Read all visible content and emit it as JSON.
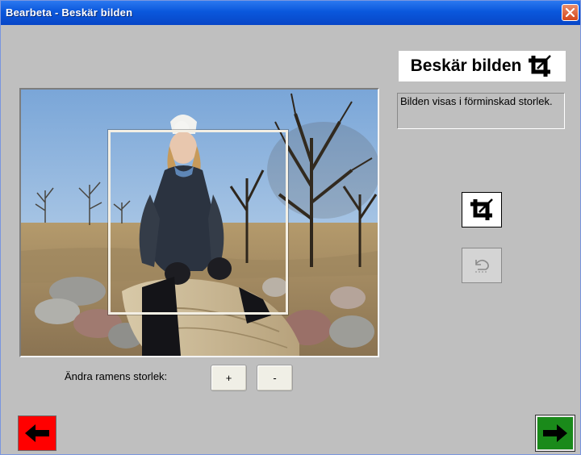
{
  "window": {
    "title": "Bearbeta - Beskär bilden"
  },
  "panel": {
    "heading": "Beskär bilden",
    "info": "Bilden visas i förminskad storlek."
  },
  "frame_controls": {
    "label": "Ändra ramens storlek:",
    "increase_label": "+",
    "decrease_label": "-"
  },
  "icons": {
    "close": "close-icon",
    "crop": "crop-icon",
    "undo": "undo-icon",
    "back": "arrow-left-icon",
    "next": "arrow-right-icon"
  },
  "colors": {
    "titlebar": "#0a57dc",
    "background": "#bfbfbf",
    "back_button": "#ff0000",
    "next_button": "#1a8a1a"
  }
}
